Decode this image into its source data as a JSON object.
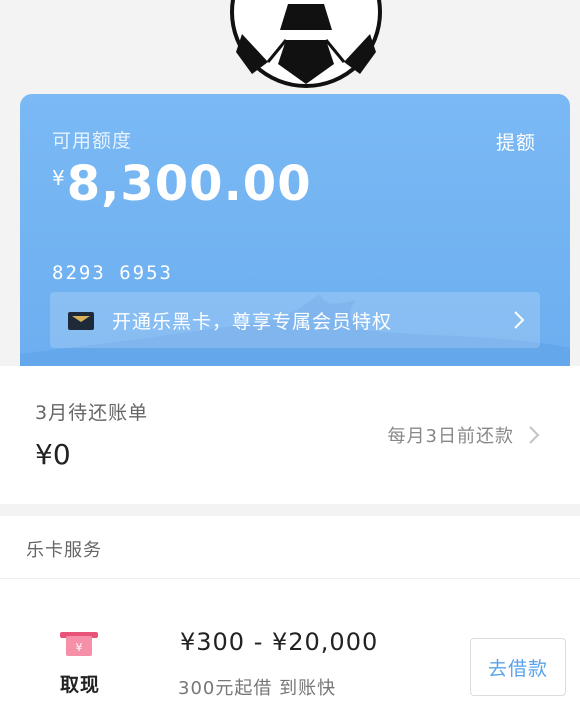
{
  "card": {
    "label": "可用额度",
    "raise_label": "提额",
    "currency": "¥",
    "amount": "8,300.00",
    "number": "8293 6953",
    "promo_text": "开通乐黑卡，尊享专属会员特权"
  },
  "bill": {
    "title": "3月待还账单",
    "amount": "¥0",
    "due_text": "每月3日前还款"
  },
  "services": {
    "title": "乐卡服务",
    "item": {
      "name": "取现",
      "range": "¥300 - ¥20,000",
      "subtitle": "300元起借  到账快",
      "button": "去借款"
    }
  },
  "colors": {
    "card_blue": "#7ab9f4",
    "accent": "#5aa3ec",
    "icon_pink": "#f06a8a"
  },
  "icons": [
    "soccer-ball-icon",
    "black-card-icon",
    "chevron-right-icon",
    "cash-icon"
  ]
}
